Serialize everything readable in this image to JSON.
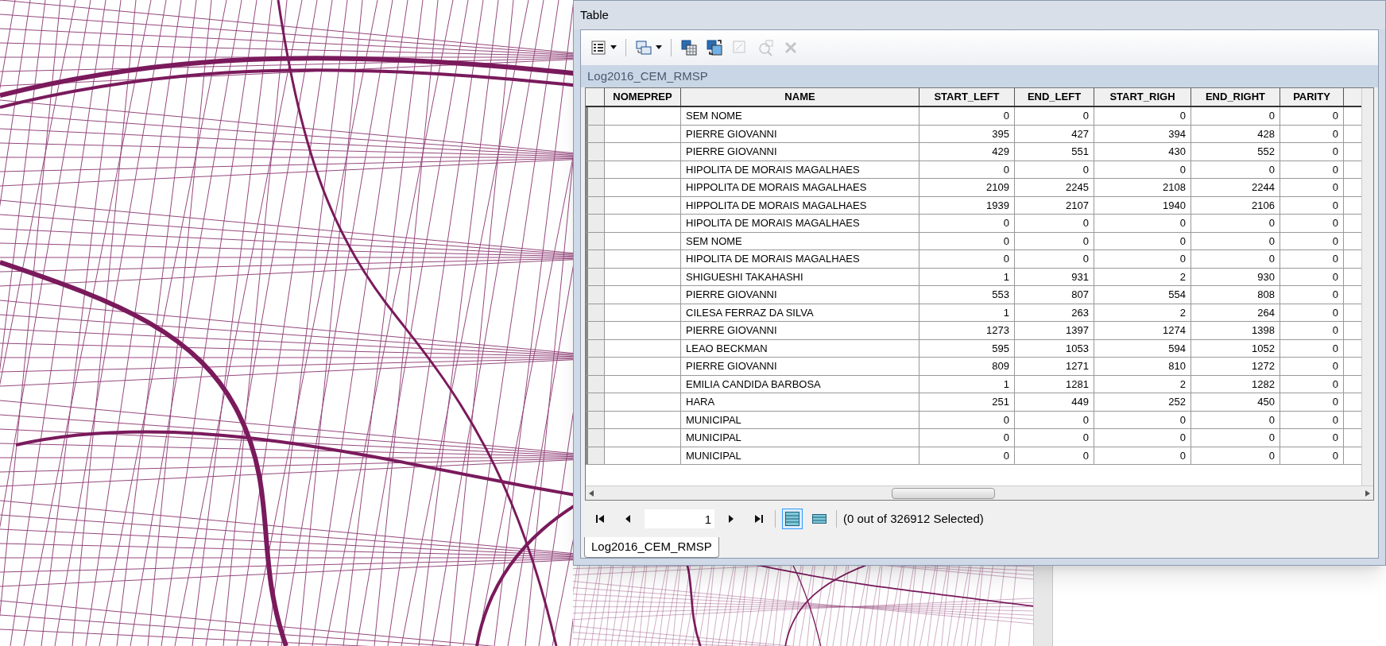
{
  "window": {
    "title": "Table"
  },
  "toolbar": [
    {
      "kind": "options",
      "disabled": false,
      "dropdown": true
    },
    {
      "kind": "relate",
      "disabled": false,
      "dropdown": true
    },
    {
      "kind": "select",
      "disabled": false,
      "dropdown": false
    },
    {
      "kind": "switch",
      "disabled": false,
      "dropdown": false
    },
    {
      "kind": "clear",
      "disabled": true,
      "dropdown": false
    },
    {
      "kind": "zoom",
      "disabled": true,
      "dropdown": false
    },
    {
      "kind": "delete",
      "disabled": true,
      "dropdown": false
    }
  ],
  "table_name": "Log2016_CEM_RMSP",
  "table": {
    "columns": [
      "NOMEPREP",
      "NAME",
      "START_LEFT",
      "END_LEFT",
      "START_RIGH",
      "END_RIGHT",
      "PARITY"
    ],
    "rows": [
      [
        "",
        "SEM NOME",
        "0",
        "0",
        "0",
        "0",
        "0"
      ],
      [
        "",
        "PIERRE GIOVANNI",
        "395",
        "427",
        "394",
        "428",
        "0"
      ],
      [
        "",
        "PIERRE GIOVANNI",
        "429",
        "551",
        "430",
        "552",
        "0"
      ],
      [
        "",
        "HIPOLITA DE MORAIS MAGALHAES",
        "0",
        "0",
        "0",
        "0",
        "0"
      ],
      [
        "",
        "HIPPOLITA DE MORAIS MAGALHAES",
        "2109",
        "2245",
        "2108",
        "2244",
        "0"
      ],
      [
        "",
        "HIPPOLITA DE MORAIS MAGALHAES",
        "1939",
        "2107",
        "1940",
        "2106",
        "0"
      ],
      [
        "",
        "HIPOLITA DE MORAIS MAGALHAES",
        "0",
        "0",
        "0",
        "0",
        "0"
      ],
      [
        "",
        "SEM NOME",
        "0",
        "0",
        "0",
        "0",
        "0"
      ],
      [
        "",
        "HIPOLITA DE MORAIS MAGALHAES",
        "0",
        "0",
        "0",
        "0",
        "0"
      ],
      [
        "",
        "SHIGUESHI TAKAHASHI",
        "1",
        "931",
        "2",
        "930",
        "0"
      ],
      [
        "",
        "PIERRE GIOVANNI",
        "553",
        "807",
        "554",
        "808",
        "0"
      ],
      [
        "",
        "CILESA FERRAZ DA SILVA",
        "1",
        "263",
        "2",
        "264",
        "0"
      ],
      [
        "",
        "PIERRE GIOVANNI",
        "1273",
        "1397",
        "1274",
        "1398",
        "0"
      ],
      [
        "",
        "LEAO BECKMAN",
        "595",
        "1053",
        "594",
        "1052",
        "0"
      ],
      [
        "",
        "PIERRE GIOVANNI",
        "809",
        "1271",
        "810",
        "1272",
        "0"
      ],
      [
        "",
        "EMILIA CANDIDA BARBOSA",
        "1",
        "1281",
        "2",
        "1282",
        "0"
      ],
      [
        "",
        "HARA",
        "251",
        "449",
        "252",
        "450",
        "0"
      ],
      [
        "",
        "MUNICIPAL",
        "0",
        "0",
        "0",
        "0",
        "0"
      ],
      [
        "",
        "MUNICIPAL",
        "0",
        "0",
        "0",
        "0",
        "0"
      ],
      [
        "",
        "MUNICIPAL",
        "0",
        "0",
        "0",
        "0",
        "0"
      ]
    ]
  },
  "navigator": {
    "page": "1",
    "status": "(0 out of 326912 Selected)"
  },
  "view_buttons": [
    {
      "kind": "all",
      "selected": true
    },
    {
      "kind": "selected",
      "selected": false
    }
  ],
  "tabs": [
    {
      "label": "Log2016_CEM_RMSP",
      "selected": true
    }
  ]
}
